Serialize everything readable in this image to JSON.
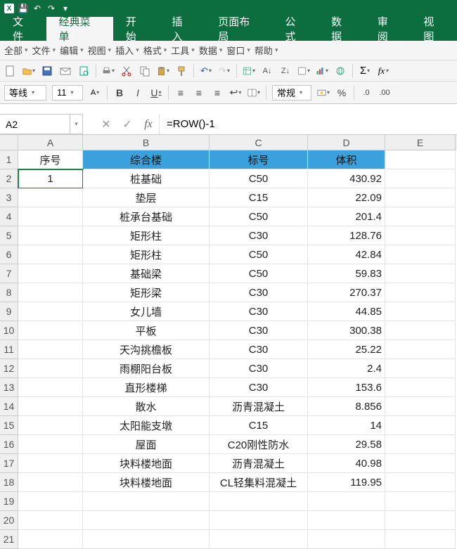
{
  "titlebar": {
    "app_icon": "X",
    "qat": [
      "save",
      "undo",
      "redo",
      "touch"
    ]
  },
  "ribbon": {
    "tabs": [
      "文件",
      "经典菜单",
      "开始",
      "插入",
      "页面布局",
      "公式",
      "数据",
      "审阅",
      "视图"
    ],
    "active_index": 1
  },
  "menubar": [
    "全部",
    "文件",
    "编辑",
    "视图",
    "插入",
    "格式",
    "工具",
    "数据",
    "窗口",
    "帮助"
  ],
  "format": {
    "style_label": "等线",
    "font_size": "11",
    "number_format": "常规"
  },
  "namebox": {
    "ref": "A2"
  },
  "formula_bar": {
    "value": "=ROW()-1"
  },
  "columns": [
    "A",
    "B",
    "C",
    "D",
    "E"
  ],
  "sheet": {
    "header": {
      "a": "序号",
      "b": "综合楼",
      "c": "标号",
      "d": "体积"
    },
    "rows": [
      {
        "n": 1,
        "a": "1",
        "b": "桩基础",
        "c": "C50",
        "d": "430.92"
      },
      {
        "n": 2,
        "a": "",
        "b": "垫层",
        "c": "C15",
        "d": "22.09"
      },
      {
        "n": 3,
        "a": "",
        "b": "桩承台基础",
        "c": "C50",
        "d": "201.4"
      },
      {
        "n": 4,
        "a": "",
        "b": "矩形柱",
        "c": "C30",
        "d": "128.76"
      },
      {
        "n": 5,
        "a": "",
        "b": "矩形柱",
        "c": "C50",
        "d": "42.84"
      },
      {
        "n": 6,
        "a": "",
        "b": "基础梁",
        "c": "C50",
        "d": "59.83"
      },
      {
        "n": 7,
        "a": "",
        "b": "矩形梁",
        "c": "C30",
        "d": "270.37"
      },
      {
        "n": 8,
        "a": "",
        "b": "女儿墙",
        "c": "C30",
        "d": "44.85"
      },
      {
        "n": 9,
        "a": "",
        "b": "平板",
        "c": "C30",
        "d": "300.38"
      },
      {
        "n": 10,
        "a": "",
        "b": "天沟挑檐板",
        "c": "C30",
        "d": "25.22"
      },
      {
        "n": 11,
        "a": "",
        "b": "雨棚阳台板",
        "c": "C30",
        "d": "2.4"
      },
      {
        "n": 12,
        "a": "",
        "b": "直形楼梯",
        "c": "C30",
        "d": "153.6"
      },
      {
        "n": 13,
        "a": "",
        "b": "散水",
        "c": "沥青混凝土",
        "d": "8.856"
      },
      {
        "n": 14,
        "a": "",
        "b": "太阳能支墩",
        "c": "C15",
        "d": "14"
      },
      {
        "n": 15,
        "a": "",
        "b": "屋面",
        "c": "C20刚性防水",
        "d": "29.58"
      },
      {
        "n": 16,
        "a": "",
        "b": "块料楼地面",
        "c": "沥青混凝土",
        "d": "40.98"
      },
      {
        "n": 17,
        "a": "",
        "b": "块料楼地面",
        "c": "CL轻集料混凝土",
        "d": "119.95"
      }
    ],
    "blank_rows": [
      19,
      20,
      21
    ]
  }
}
